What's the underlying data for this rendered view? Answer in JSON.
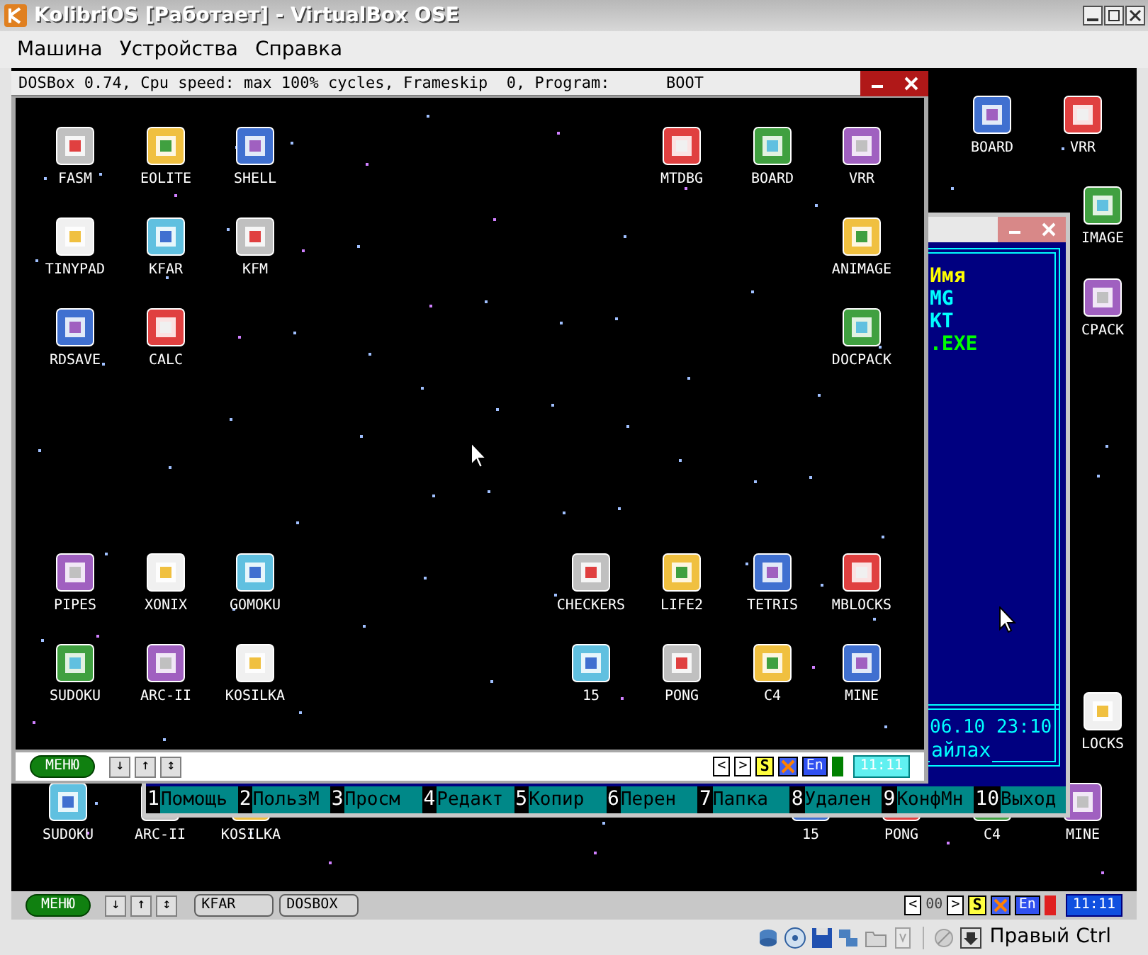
{
  "window": {
    "title": "KolibriOS [Работает] - VirtualBox OSE"
  },
  "menu": [
    "Машина",
    "Устройства",
    "Справка"
  ],
  "guest": {
    "desktop_icons": [
      {
        "label": "BOARD"
      },
      {
        "label": "VRR"
      },
      {
        "label": "IMAGE"
      },
      {
        "label": "CPACK"
      },
      {
        "label": "LOCKS"
      },
      {
        "label": "SUDOKU"
      },
      {
        "label": "ARC-II"
      },
      {
        "label": "KOSILKA"
      },
      {
        "label": "15"
      },
      {
        "label": "PONG"
      },
      {
        "label": "C4"
      },
      {
        "label": "MINE"
      }
    ],
    "kfar_window": {
      "panel_lines": [
        {
          "text": "Имя",
          "color": "#ffff00"
        },
        {
          "text": "MG",
          "color": "#00ffff"
        },
        {
          "text": "KT",
          "color": "#00ffff"
        },
        {
          "text": ".EXE",
          "color": "#00ff00"
        }
      ],
      "date_time": "06.10 23:10",
      "info_text": "айлах",
      "keybar": [
        {
          "key": "1",
          "label": "Помощь"
        },
        {
          "key": "2",
          "label": "ПользМ"
        },
        {
          "key": "3",
          "label": "Просм"
        },
        {
          "key": "4",
          "label": "Редакт"
        },
        {
          "key": "5",
          "label": "Копир"
        },
        {
          "key": "6",
          "label": "Перен"
        },
        {
          "key": "7",
          "label": "Папка"
        },
        {
          "key": "8",
          "label": "Удален"
        },
        {
          "key": "9",
          "label": "КонфМн"
        },
        {
          "key": "10",
          "label": "Выход"
        }
      ]
    },
    "dosbox_window": {
      "title": "DOSBox 0.74, Cpu speed: max 100% cycles, Frameskip  0, Program:      BOOT",
      "icons": [
        {
          "label": "FASM"
        },
        {
          "label": "EOLITE"
        },
        {
          "label": "SHELL"
        },
        {
          "label": "MTDBG"
        },
        {
          "label": "BOARD"
        },
        {
          "label": "VRR"
        },
        {
          "label": "TINYPAD"
        },
        {
          "label": "KFAR"
        },
        {
          "label": "KFM"
        },
        {
          "label": "ANIMAGE"
        },
        {
          "label": "RDSAVE"
        },
        {
          "label": "CALC"
        },
        {
          "label": "DOCPACK"
        },
        {
          "label": "PIPES"
        },
        {
          "label": "XONIX"
        },
        {
          "label": "GOMOKU"
        },
        {
          "label": "CHECKERS"
        },
        {
          "label": "LIFE2"
        },
        {
          "label": "TETRIS"
        },
        {
          "label": "MBLOCKS"
        },
        {
          "label": "SUDOKU"
        },
        {
          "label": "ARC-II"
        },
        {
          "label": "KOSILKA"
        },
        {
          "label": "15"
        },
        {
          "label": "PONG"
        },
        {
          "label": "C4"
        },
        {
          "label": "MINE"
        }
      ],
      "taskbar": {
        "menu_button": "МЕНЮ",
        "arrow_buttons": [
          "↓",
          "↑",
          "↕"
        ],
        "tray": [
          {
            "kind": "box",
            "text": "<"
          },
          {
            "kind": "box",
            "text": ">"
          },
          {
            "kind": "sound",
            "text": "S"
          },
          {
            "kind": "crossed"
          },
          {
            "kind": "lang",
            "text": "En"
          },
          {
            "kind": "indicator",
            "color": "#008000"
          }
        ],
        "clock": "11:11"
      }
    },
    "taskbar": {
      "menu_button": "МЕНЮ",
      "arrow_buttons": [
        "↓",
        "↑",
        "↕"
      ],
      "tasks": [
        "KFAR",
        "DOSBOX"
      ],
      "tray": [
        {
          "kind": "box",
          "text": "<"
        },
        {
          "kind": "plain",
          "text": "00"
        },
        {
          "kind": "box",
          "text": ">"
        },
        {
          "kind": "sound",
          "text": "S"
        },
        {
          "kind": "crossed"
        },
        {
          "kind": "lang",
          "text": "En"
        },
        {
          "kind": "indicator",
          "color": "#e02020"
        }
      ],
      "clock": "11:11"
    }
  },
  "status_bar": {
    "host_key": "Правый Ctrl"
  }
}
